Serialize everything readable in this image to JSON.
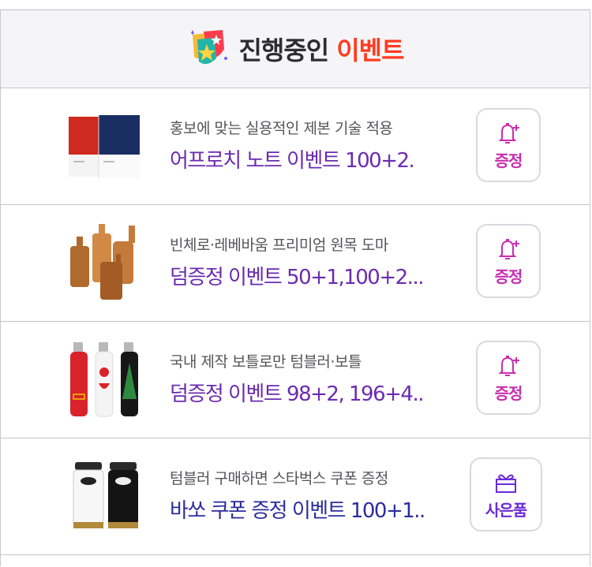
{
  "header": {
    "title_main": "진행중인",
    "title_accent": "이벤트",
    "icon": "shield-star-icon"
  },
  "colors": {
    "accent": "#ff3b1f",
    "item_text": "#6b2bb0",
    "item_text_alt": "#2c2c9e",
    "button_pink": "#c72fb0",
    "button_purple": "#6c2bd9"
  },
  "events": [
    {
      "subtitle": "홍보에 맞는 실용적인 제본 기술 적용",
      "title": "어프로치 노트 이벤트 100+2.",
      "button_label": "증정",
      "button_icon": "bell-plus-icon",
      "image": "notebook-image"
    },
    {
      "subtitle": "빈체로·레베바움 프리미엄 원목 도마",
      "title": "덤증정 이벤트 50+1,100+2...",
      "button_label": "증정",
      "button_icon": "bell-plus-icon",
      "image": "cutting-board-image"
    },
    {
      "subtitle": "국내 제작 보틀로만 텀블러·보틀",
      "title": "덤증정 이벤트 98+2, 196+4..",
      "button_label": "증정",
      "button_icon": "bell-plus-icon",
      "image": "bottle-image"
    },
    {
      "subtitle": "텀블러 구매하면 스타벅스 쿠폰 증정",
      "title": "바쏘 쿠폰 증정 이벤트 100+1..",
      "button_label": "사은품",
      "button_icon": "gift-icon",
      "image": "tumbler-image"
    }
  ]
}
